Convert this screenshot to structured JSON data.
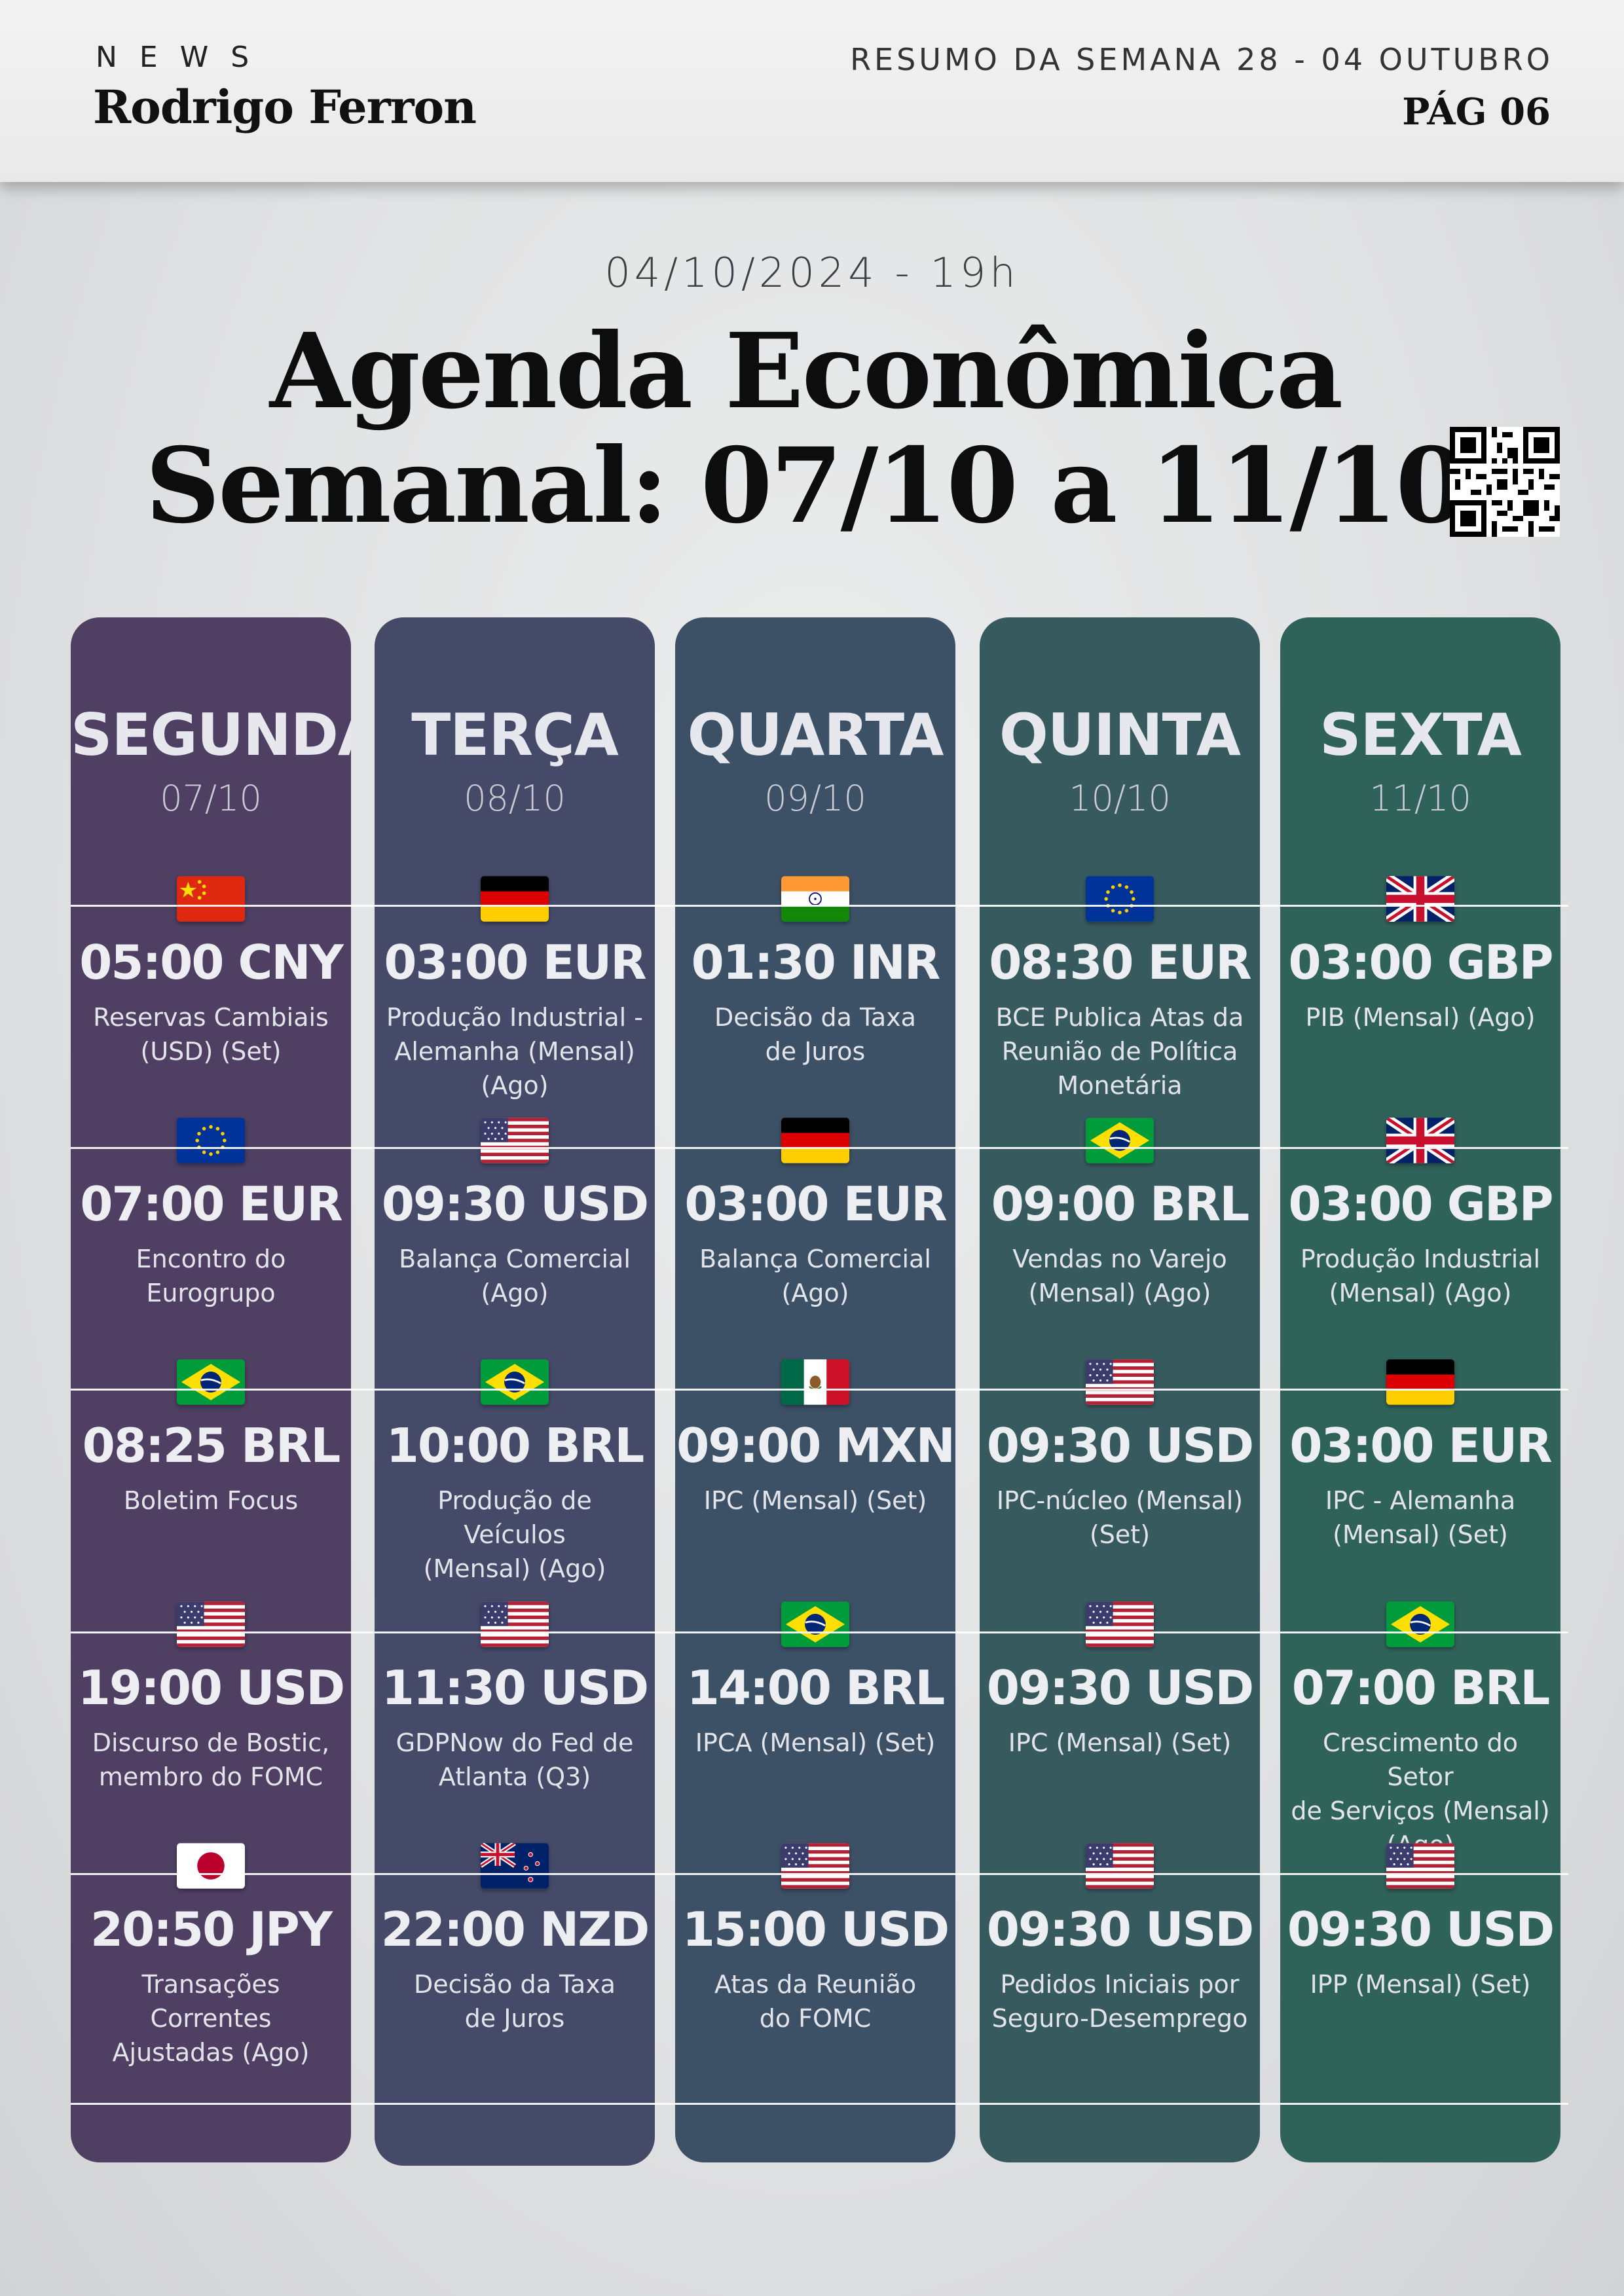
{
  "header": {
    "brand_small": "NEWS",
    "brand_name": "Rodrigo Ferron",
    "week": "RESUMO DA SEMANA 28 - 04 OUTUBRO",
    "page": "PÁG 06"
  },
  "hero": {
    "datetime": "04/10/2024 - 19h",
    "title_line1": "Agenda Econômica",
    "title_line2": "Semanal: 07/10 a 11/10"
  },
  "colors": {
    "segunda": "#4e3f63",
    "terca": "#444a68",
    "quarta": "#3c5066",
    "quinta": "#375a5f",
    "sexta": "#2f6259"
  },
  "days": [
    {
      "name": "SEGUNDA",
      "date": "07/10",
      "events": [
        {
          "flag": "cn-flag-icon",
          "time": "05:00 CNY",
          "desc": "Reservas Cambiais\n(USD) (Set)"
        },
        {
          "flag": "eu-flag-icon",
          "time": "07:00 EUR",
          "desc": "Encontro do Eurogrupo"
        },
        {
          "flag": "br-flag-icon",
          "time": "08:25 BRL",
          "desc": "Boletim Focus"
        },
        {
          "flag": "us-flag-icon",
          "time": "19:00 USD",
          "desc": "Discurso de Bostic,\nmembro do FOMC"
        },
        {
          "flag": "jp-flag-icon",
          "time": "20:50 JPY",
          "desc": "Transações Correntes\nAjustadas (Ago)"
        }
      ]
    },
    {
      "name": "TERÇA",
      "date": "08/10",
      "events": [
        {
          "flag": "de-flag-icon",
          "time": "03:00 EUR",
          "desc": "Produção Industrial -\nAlemanha (Mensal)\n(Ago)"
        },
        {
          "flag": "us-flag-icon",
          "time": "09:30 USD",
          "desc": "Balança Comercial (Ago)"
        },
        {
          "flag": "br-flag-icon",
          "time": "10:00 BRL",
          "desc": "Produção de Veículos\n(Mensal) (Ago)"
        },
        {
          "flag": "us-flag-icon",
          "time": "11:30 USD",
          "desc": "GDPNow do Fed de\nAtlanta (Q3)"
        },
        {
          "flag": "nz-flag-icon",
          "time": "22:00 NZD",
          "desc": "Decisão da Taxa\nde Juros"
        }
      ]
    },
    {
      "name": "QUARTA",
      "date": "09/10",
      "events": [
        {
          "flag": "in-flag-icon",
          "time": "01:30 INR",
          "desc": "Decisão da Taxa\nde Juros"
        },
        {
          "flag": "de-flag-icon",
          "time": "03:00 EUR",
          "desc": "Balança Comercial\n(Ago)"
        },
        {
          "flag": "mx-flag-icon",
          "time": "09:00 MXN",
          "desc": "IPC (Mensal) (Set)"
        },
        {
          "flag": "br-flag-icon",
          "time": "14:00 BRL",
          "desc": "IPCA (Mensal) (Set)"
        },
        {
          "flag": "us-flag-icon",
          "time": "15:00 USD",
          "desc": "Atas da Reunião\ndo FOMC"
        }
      ]
    },
    {
      "name": "QUINTA",
      "date": "10/10",
      "events": [
        {
          "flag": "eu-flag-icon",
          "time": "08:30 EUR",
          "desc": "BCE Publica Atas da\nReunião de Política\nMonetária"
        },
        {
          "flag": "br-flag-icon",
          "time": "09:00 BRL",
          "desc": "Vendas no Varejo\n(Mensal) (Ago)"
        },
        {
          "flag": "us-flag-icon",
          "time": "09:30 USD",
          "desc": "IPC-núcleo (Mensal)\n(Set)"
        },
        {
          "flag": "us-flag-icon",
          "time": "09:30 USD",
          "desc": "IPC (Mensal) (Set)"
        },
        {
          "flag": "us-flag-icon",
          "time": "09:30 USD",
          "desc": "Pedidos Iniciais por\nSeguro-Desemprego"
        }
      ]
    },
    {
      "name": "SEXTA",
      "date": "11/10",
      "events": [
        {
          "flag": "gb-flag-icon",
          "time": "03:00 GBP",
          "desc": "PIB (Mensal) (Ago)"
        },
        {
          "flag": "gb-flag-icon",
          "time": "03:00 GBP",
          "desc": "Produção Industrial\n(Mensal) (Ago)"
        },
        {
          "flag": "de-flag-icon",
          "time": "03:00 EUR",
          "desc": "IPC - Alemanha\n(Mensal) (Set)"
        },
        {
          "flag": "br-flag-icon",
          "time": "07:00 BRL",
          "desc": "Crescimento do Setor\nde Serviços (Mensal)\n(Ago)"
        },
        {
          "flag": "us-flag-icon",
          "time": "09:30 USD",
          "desc": "IPP (Mensal) (Set)"
        }
      ]
    }
  ]
}
